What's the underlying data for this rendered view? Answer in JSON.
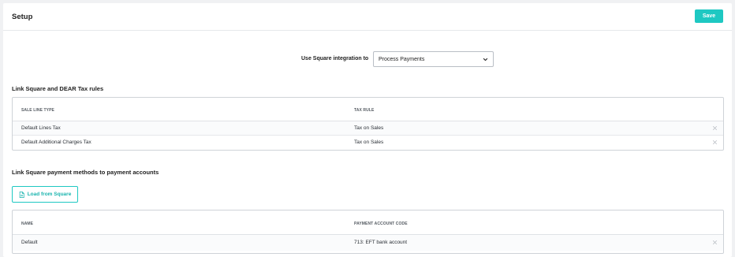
{
  "header": {
    "title": "Setup",
    "save_label": "Save"
  },
  "integration": {
    "label": "Use Square integration to",
    "selected": "Process Payments"
  },
  "tax_rules": {
    "heading": "Link Square and DEAR Tax rules",
    "columns": [
      "SALE LINE TYPE",
      "TAX RULE"
    ],
    "rows": [
      {
        "line_type": "Default Lines Tax",
        "tax_rule": "Tax on Sales"
      },
      {
        "line_type": "Default Additional Charges Tax",
        "tax_rule": "Tax on Sales"
      }
    ]
  },
  "payment_methods": {
    "heading": "Link Square payment methods to payment accounts",
    "load_button": "Load from Square",
    "columns": [
      "NAME",
      "PAYMENT ACCOUNT CODE"
    ],
    "rows": [
      {
        "name": "Default",
        "account": "713: EFT bank account"
      }
    ]
  },
  "colors": {
    "accent": "#1ec8c2",
    "background": "#f0f1f3"
  },
  "icons": {
    "select": "chevron-down-icon",
    "row_delete": "close-icon",
    "load": "document-icon"
  }
}
